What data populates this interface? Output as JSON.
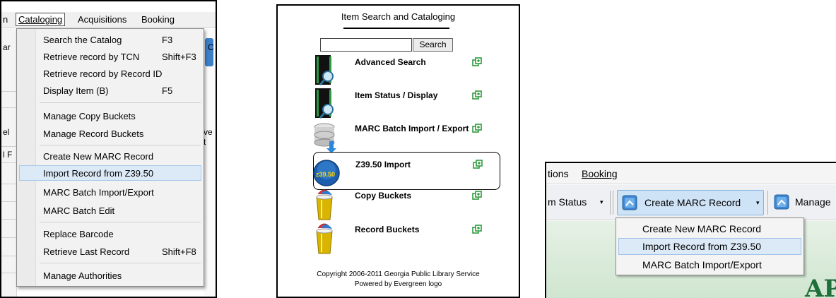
{
  "panel1": {
    "menubar": {
      "left_fragment": "n",
      "active": "Cataloging",
      "items": [
        "Acquisitions",
        "Booking"
      ]
    },
    "bg_fragments": [
      "ar",
      "el",
      "l F",
      "ve t",
      "C"
    ],
    "menu": [
      {
        "label": "Search the Catalog",
        "shortcut": "F3"
      },
      {
        "label": "Retrieve record by TCN",
        "shortcut": "Shift+F3"
      },
      {
        "label": "Retrieve record by Record ID",
        "shortcut": ""
      },
      {
        "label": "Display Item (B)",
        "shortcut": "F5"
      },
      {
        "label": "Manage Copy Buckets",
        "shortcut": ""
      },
      {
        "label": "Manage Record Buckets",
        "shortcut": ""
      },
      {
        "label": "Create New MARC Record",
        "shortcut": ""
      },
      {
        "label": "Import Record from Z39.50",
        "shortcut": "",
        "highlighted": true
      },
      {
        "label": "MARC Batch Import/Export",
        "shortcut": ""
      },
      {
        "label": "MARC Batch Edit",
        "shortcut": ""
      },
      {
        "label": "Replace Barcode",
        "shortcut": ""
      },
      {
        "label": "Retrieve Last Record",
        "shortcut": "Shift+F8"
      },
      {
        "label": "Manage Authorities",
        "shortcut": ""
      }
    ]
  },
  "panel2": {
    "title": "Item Search and Cataloging",
    "search_value": "",
    "search_button": "Search",
    "tools": [
      {
        "name": "Advanced Search",
        "icon": "book-search-icon"
      },
      {
        "name": "Item Status / Display",
        "icon": "book-search-icon"
      },
      {
        "name": "MARC Batch Import / Export",
        "icon": "database-icon"
      },
      {
        "name": "Z39.50 Import",
        "icon": "z3950-icon",
        "icon_text": "z39.50"
      },
      {
        "name": "Copy Buckets",
        "icon": "bucket-icon"
      },
      {
        "name": "Record Buckets",
        "icon": "bucket-icon"
      }
    ],
    "footer_line1": "Copyright 2006-2011 Georgia Public Library Service",
    "footer_line2": "Powered by Evergreen logo"
  },
  "panel3": {
    "menubar": {
      "left_fragment": "tions",
      "items": [
        "Booking"
      ]
    },
    "toolbar": {
      "item_status": "m Status",
      "create_marc": "Create MARC Record",
      "manage": "Manage"
    },
    "menu": [
      {
        "label": "Create New MARC Record"
      },
      {
        "label": "Import Record from Z39.50",
        "highlighted": true
      },
      {
        "label": "MARC Batch Import/Export"
      }
    ],
    "logo_fragment": "AP"
  },
  "colors": {
    "highlight_bg": "#dceaf8",
    "highlight_border": "#a8c8ea",
    "green_icon": "#2e9b3e",
    "content_green": "#d8ebd8"
  }
}
